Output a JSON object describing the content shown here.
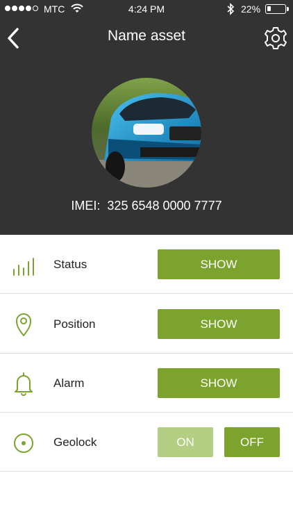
{
  "status_bar": {
    "carrier": "MTC",
    "time": "4:24 PM",
    "battery_percent": "22%",
    "battery_level": 0.22,
    "signal_bars_filled": 4,
    "signal_bars_total": 5
  },
  "nav": {
    "title": "Name asset",
    "back_icon": "chevron-left-icon",
    "settings_icon": "gear-icon"
  },
  "asset": {
    "imei_label": "IMEI:",
    "imei_value": "325 6548 0000 7777",
    "avatar": "blue car photo"
  },
  "rows": [
    {
      "label": "Status",
      "icon": "signal-bars-icon",
      "button": "SHOW"
    },
    {
      "label": "Position",
      "icon": "map-pin-icon",
      "button": "SHOW"
    },
    {
      "label": "Alarm",
      "icon": "bell-icon",
      "button": "SHOW"
    },
    {
      "label": "Geolock",
      "icon": "target-icon",
      "on_label": "ON",
      "off_label": "OFF",
      "state": "off"
    }
  ],
  "colors": {
    "header_bg": "#333333",
    "accent": "#7ba32d",
    "accent_light": "#b4ce83"
  }
}
